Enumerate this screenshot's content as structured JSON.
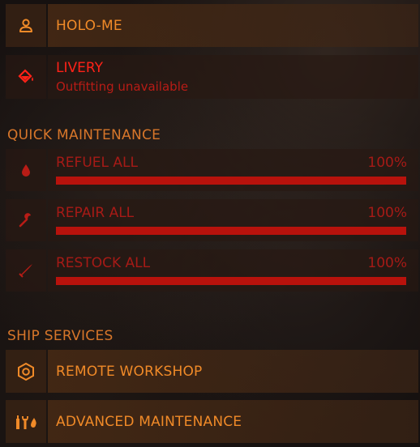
{
  "menu": {
    "holo_me": {
      "label": "HOLO-ME",
      "icon": "person-icon"
    },
    "livery": {
      "label": "LIVERY",
      "sublabel": "Outfitting unavailable",
      "icon": "paint-bucket-icon"
    }
  },
  "quick_maintenance": {
    "header": "QUICK MAINTENANCE",
    "items": [
      {
        "label": "REFUEL ALL",
        "percent": "100%",
        "level": 100,
        "icon": "fuel-drop-icon"
      },
      {
        "label": "REPAIR ALL",
        "percent": "100%",
        "level": 100,
        "icon": "wrench-icon"
      },
      {
        "label": "RESTOCK ALL",
        "percent": "100%",
        "level": 100,
        "icon": "ammo-icon"
      }
    ]
  },
  "ship_services": {
    "header": "SHIP SERVICES",
    "items": [
      {
        "label": "REMOTE WORKSHOP",
        "icon": "hexagon-nut-icon"
      },
      {
        "label": "ADVANCED MAINTENANCE",
        "icon": "maintenance-tools-icon"
      }
    ]
  },
  "colors": {
    "accent_orange": "#f08a28",
    "disabled_red": "#a61a16",
    "alert_red": "#ff2218",
    "bar_red": "#b8120c"
  }
}
